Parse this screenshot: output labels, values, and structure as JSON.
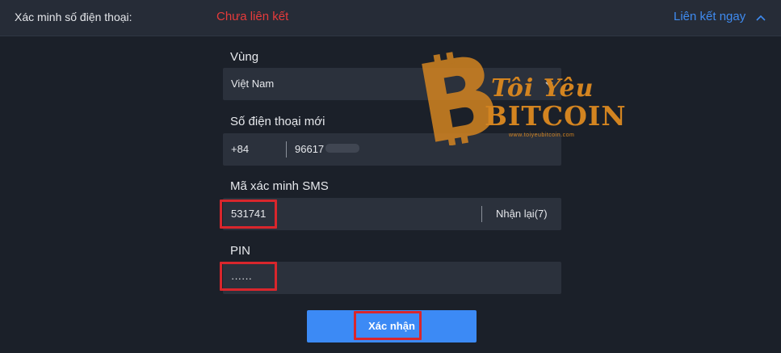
{
  "header": {
    "label": "Xác minh số điện thoại:",
    "status": "Chưa liên kết",
    "link": "Liên kết ngay",
    "status_color": "#e63b3b",
    "link_color": "#3f8bf0"
  },
  "form": {
    "region": {
      "label": "Vùng",
      "value": "Việt Nam"
    },
    "phone": {
      "label": "Số điện thoại mới",
      "country_code": "+84",
      "number": "96617"
    },
    "sms": {
      "label": "Mã xác minh SMS",
      "value": "531741",
      "resend": "Nhận lại(7)"
    },
    "pin": {
      "label": "PIN",
      "value": "······"
    },
    "submit": "Xác nhận"
  },
  "watermark": {
    "title_line1": "Tôi Yêu",
    "title_line2": "BITCOIN",
    "url": "www.toiyeubitcoin.com",
    "coin_text": "BITCOIN",
    "brand_color": "#d38420"
  }
}
